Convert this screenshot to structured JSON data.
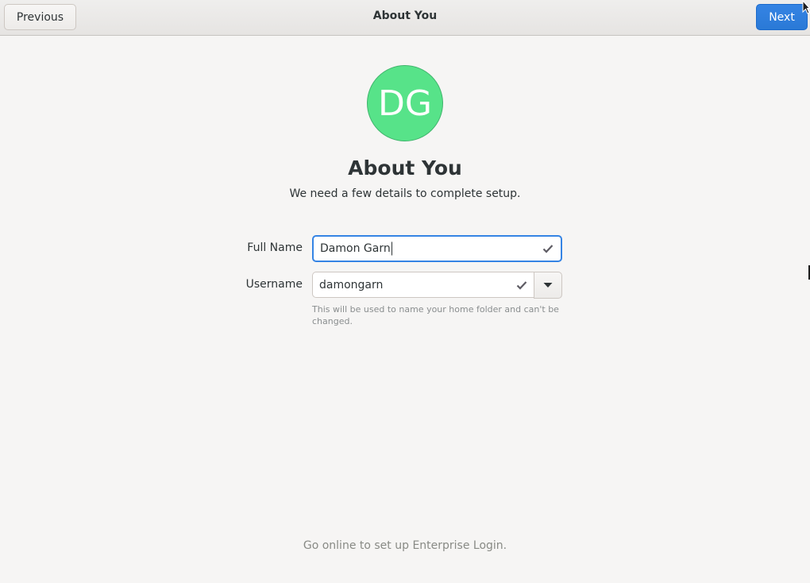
{
  "header": {
    "title": "About You",
    "previous_label": "Previous",
    "next_label": "Next"
  },
  "avatar": {
    "initials": "DG",
    "color": "#57e389"
  },
  "main": {
    "title": "About You",
    "subtitle": "We need a few details to complete setup."
  },
  "form": {
    "full_name": {
      "label": "Full Name",
      "value": "Damon Garn",
      "valid_icon": "checkmark-icon"
    },
    "username": {
      "label": "Username",
      "value": "damongarn",
      "valid_icon": "checkmark-icon",
      "dropdown_icon": "chevron-down-icon",
      "hint": "This will be used to name your home folder and can't be changed."
    }
  },
  "footer": {
    "enterprise_login": "Go online to set up Enterprise Login."
  },
  "colors": {
    "accent": "#3584e4",
    "background": "#f6f5f4"
  }
}
